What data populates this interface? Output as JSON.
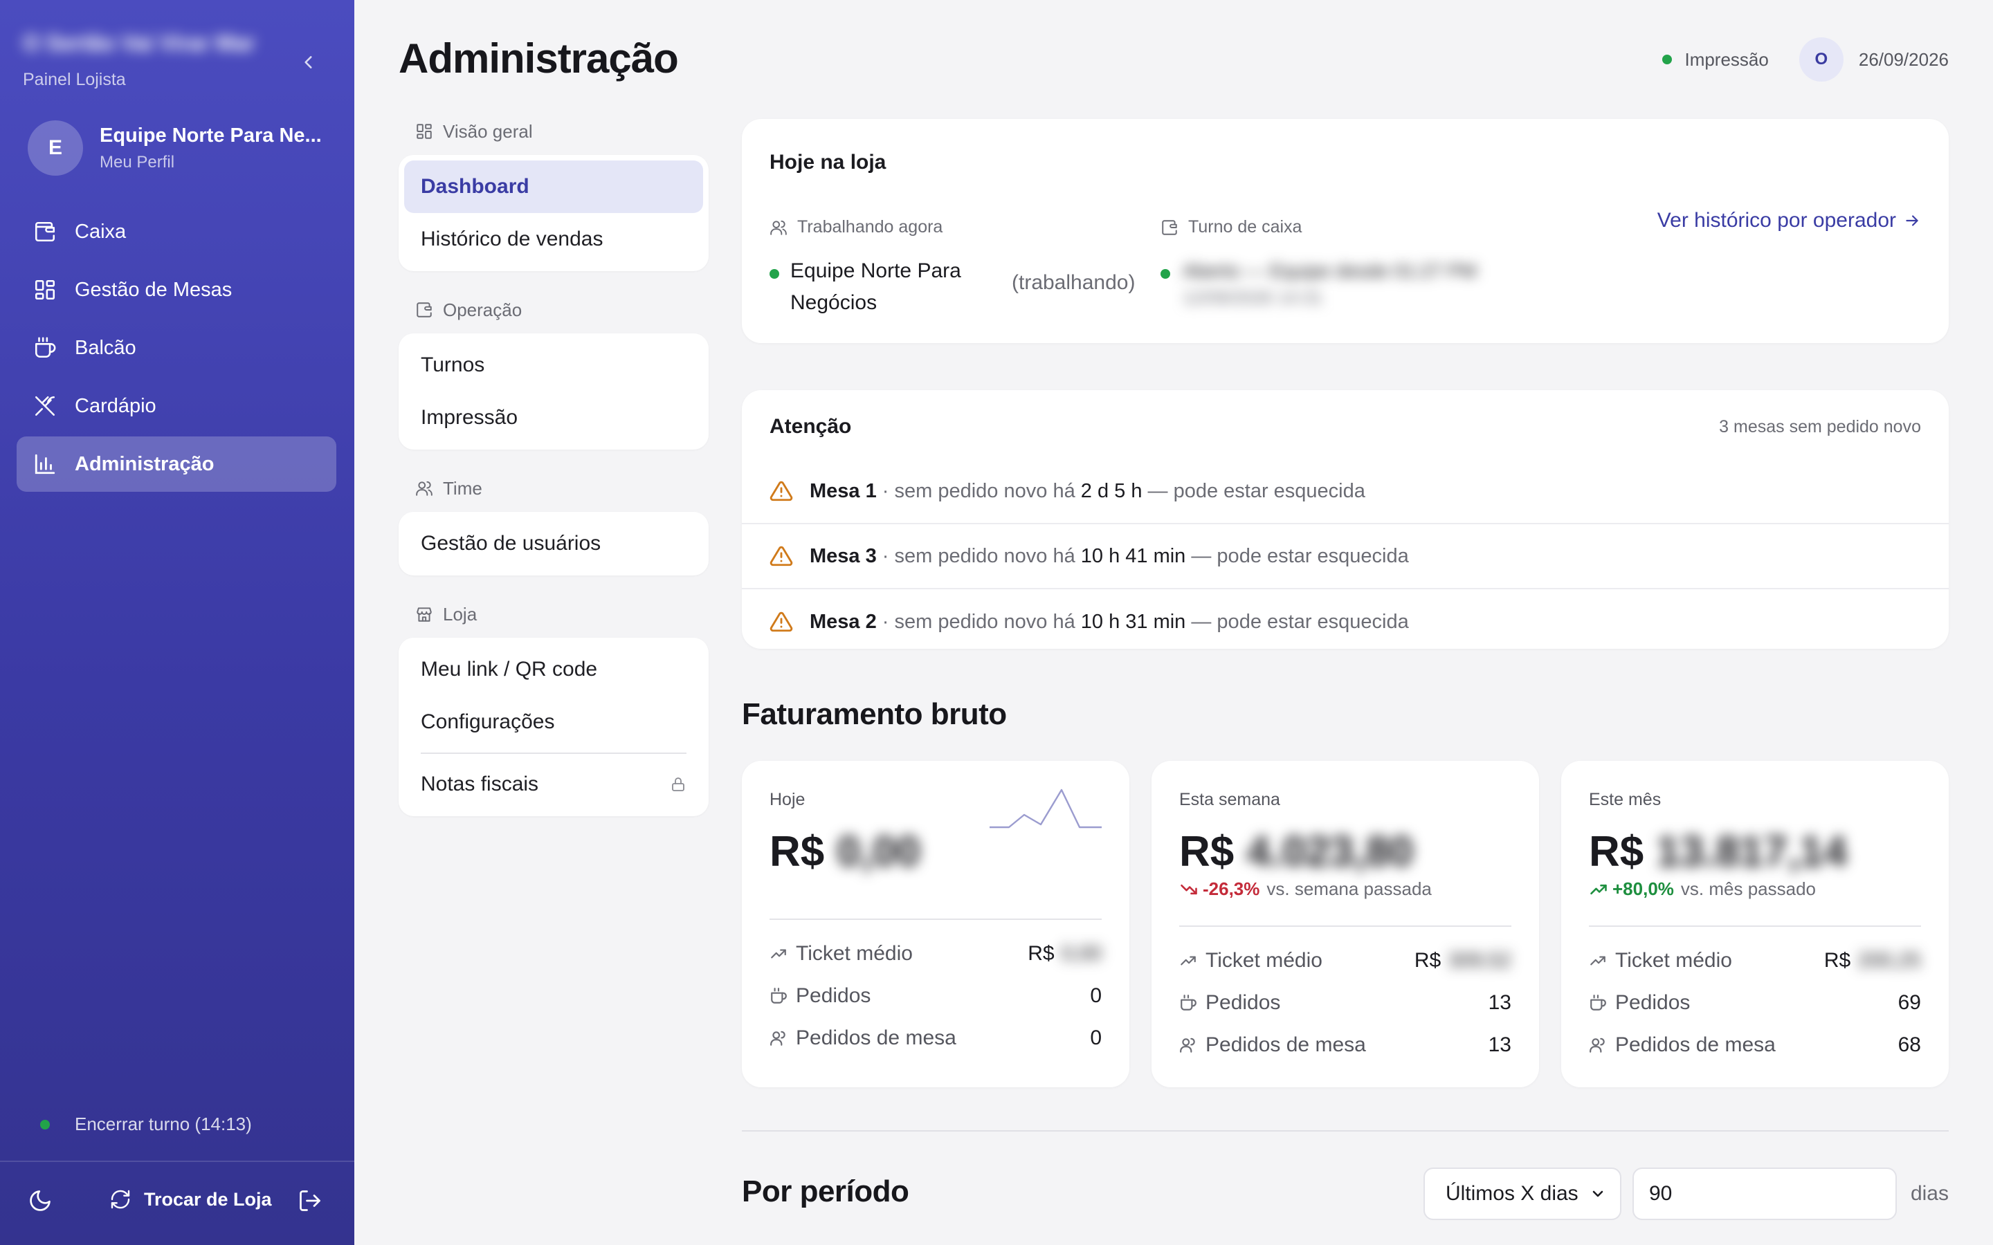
{
  "sidebar": {
    "brand_name": "O Sertão Vai Virar Mar",
    "brand_subtitle": "Painel Lojista",
    "profile": {
      "initial": "E",
      "name": "Equipe Norte Para Ne...",
      "subtitle": "Meu Perfil"
    },
    "items": [
      {
        "label": "Caixa",
        "icon": "wallet-icon"
      },
      {
        "label": "Gestão de Mesas",
        "icon": "grid-icon"
      },
      {
        "label": "Balcão",
        "icon": "coffee-cup-icon"
      },
      {
        "label": "Cardápio",
        "icon": "utensils-icon"
      },
      {
        "label": "Administração",
        "icon": "bar-chart-icon",
        "active": true
      }
    ],
    "shift_label": "Encerrar turno (14:13)",
    "switch_store_label": "Trocar de Loja"
  },
  "header": {
    "title": "Administração",
    "printer_status": "Impressão",
    "user_initial": "O",
    "date": "26/09/2026"
  },
  "subnav": {
    "sections": [
      {
        "label": "Visão geral",
        "icon": "layout-icon",
        "items": [
          "Dashboard",
          "Histórico de vendas"
        ]
      },
      {
        "label": "Operação",
        "icon": "wallet-icon",
        "items": [
          "Turnos",
          "Impressão"
        ]
      },
      {
        "label": "Time",
        "icon": "users-icon",
        "items": [
          "Gestão de usuários"
        ]
      },
      {
        "label": "Loja",
        "icon": "store-icon",
        "items": [
          "Meu link / QR code",
          "Configurações",
          "Notas fiscais"
        ]
      }
    ]
  },
  "today": {
    "title": "Hoje na loja",
    "working_label": "Trabalhando agora",
    "working_name": "Equipe Norte Para Negócios",
    "working_status": "(trabalhando)",
    "shift_label": "Turno de caixa",
    "shift_line1": "Aberto — Equipe desde 01:27 PM",
    "shift_line2": "12/09/2026 14:31",
    "history_link": "Ver histórico por operador"
  },
  "attention": {
    "title": "Atenção",
    "count_text": "3 mesas sem pedido novo",
    "alerts": [
      {
        "table": "Mesa 1",
        "prefix": "· sem pedido novo há",
        "time": "2 d 5 h",
        "suffix": "— pode estar esquecida"
      },
      {
        "table": "Mesa 3",
        "prefix": "· sem pedido novo há",
        "time": "10 h 41 min",
        "suffix": "— pode estar esquecida"
      },
      {
        "table": "Mesa 2",
        "prefix": "· sem pedido novo há",
        "time": "10 h 31 min",
        "suffix": "— pode estar esquecida"
      }
    ]
  },
  "revenue": {
    "title": "Faturamento bruto",
    "currency": "R$",
    "cards": [
      {
        "label": "Hoje",
        "amount": "0,00",
        "ticket_label": "Ticket médio",
        "ticket_value": "0,00",
        "orders_label": "Pedidos",
        "orders": "0",
        "table_orders_label": "Pedidos de mesa",
        "table_orders": "0"
      },
      {
        "label": "Esta semana",
        "amount": "4.023,80",
        "delta": "-26,3%",
        "delta_text": "vs. semana passada",
        "delta_trend": "down",
        "ticket_label": "Ticket médio",
        "ticket_value": "309,52",
        "orders_label": "Pedidos",
        "orders": "13",
        "table_orders_label": "Pedidos de mesa",
        "table_orders": "13"
      },
      {
        "label": "Este mês",
        "amount": "13.817,14",
        "delta": "+80,0%",
        "delta_text": "vs. mês passado",
        "delta_trend": "up",
        "ticket_label": "Ticket médio",
        "ticket_value": "200,25",
        "orders_label": "Pedidos",
        "orders": "69",
        "table_orders_label": "Pedidos de mesa",
        "table_orders": "68"
      }
    ]
  },
  "period": {
    "title": "Por período",
    "select_value": "Últimos X dias",
    "input_value": "90",
    "unit": "dias"
  },
  "colors": {
    "accent": "#3a3ca4",
    "sidebar_top": "#4b4cbf",
    "sidebar_bottom": "#34338f",
    "success": "#22a34a",
    "danger": "#c42b3a",
    "warning": "#d07a1a"
  }
}
